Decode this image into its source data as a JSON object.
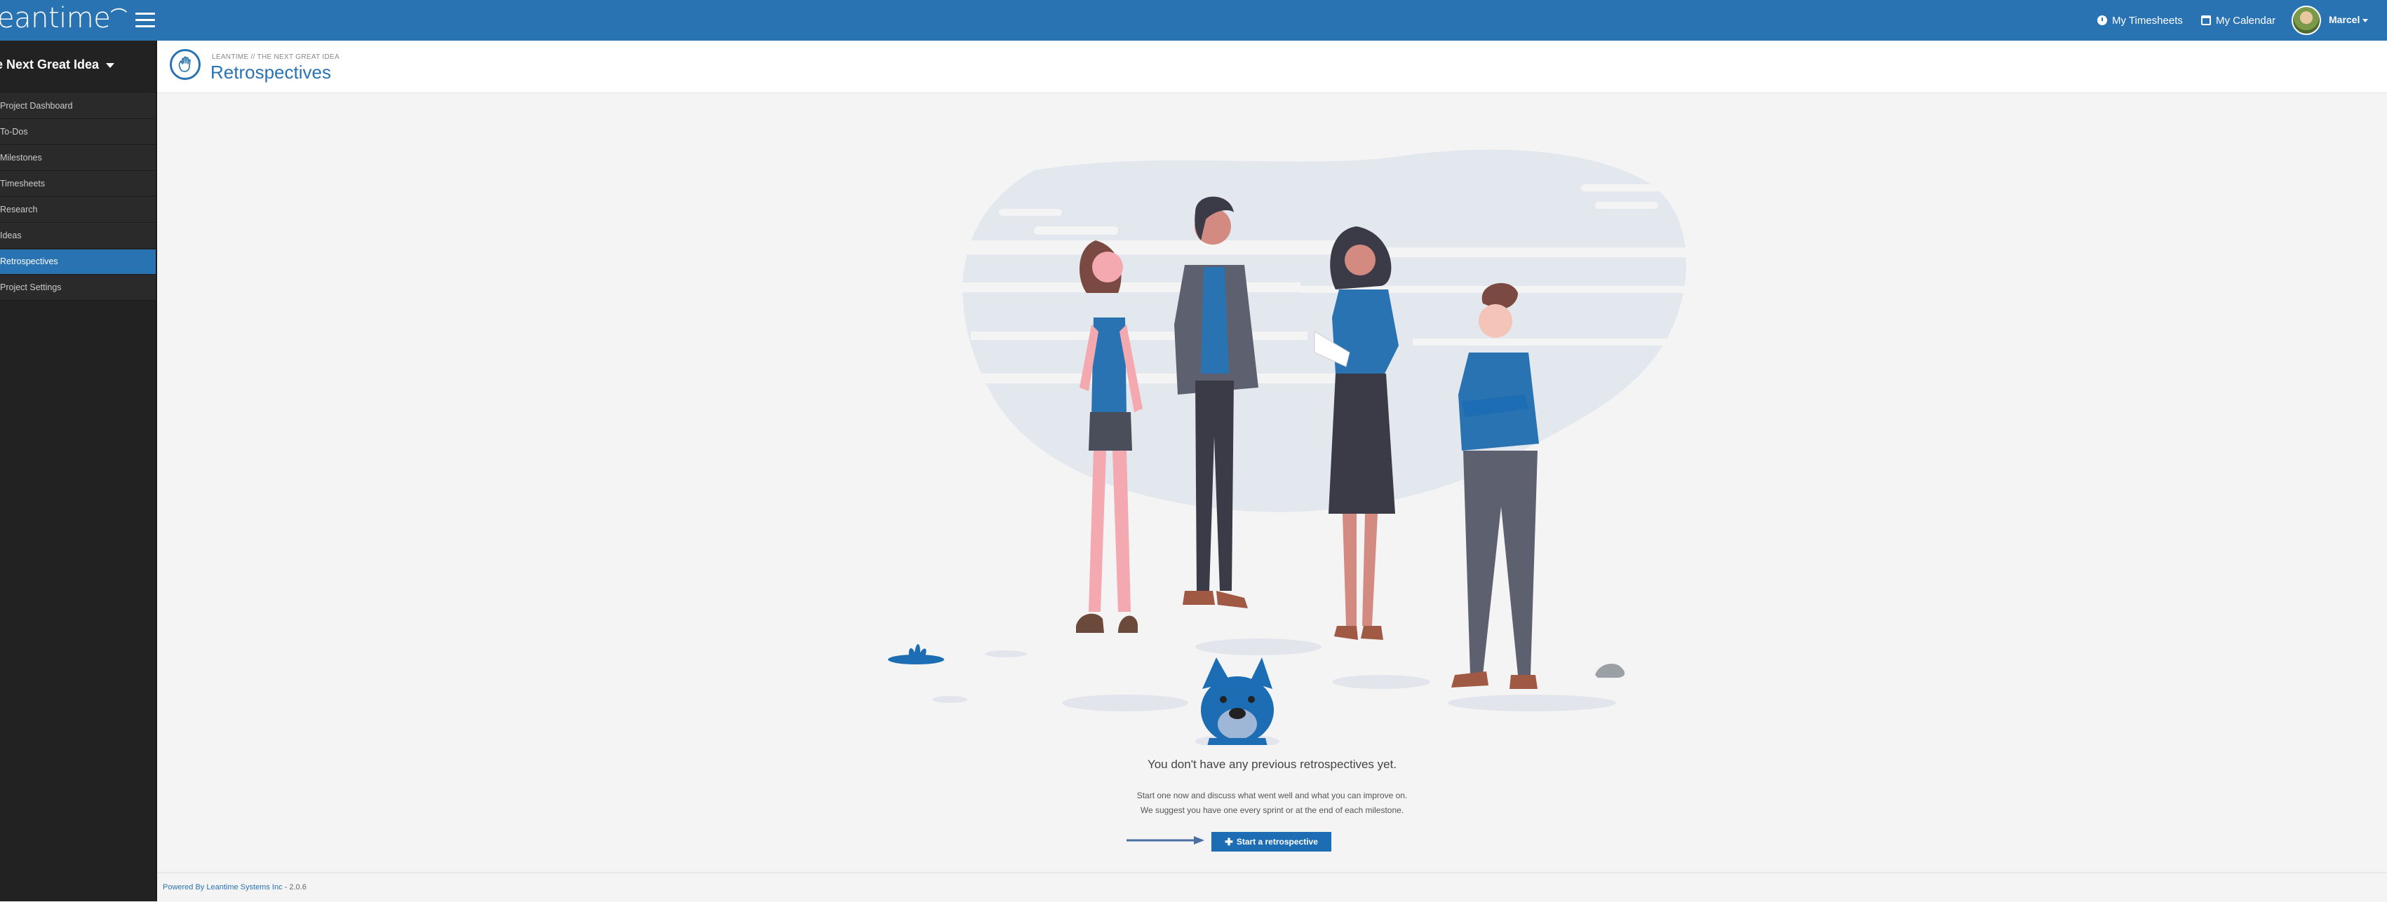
{
  "app": {
    "logo_text": "eantime",
    "colors": {
      "brand": "#2a73b2",
      "sidebar_bg": "#222222",
      "active_item": "#2a73b2"
    }
  },
  "topbar": {
    "menu_icon": "hamburger-icon",
    "timesheets_label": "My Timesheets",
    "timesheets_icon": "clock-icon",
    "calendar_label": "My Calendar",
    "calendar_icon": "calendar-icon",
    "user_name": "Marcel"
  },
  "sidebar": {
    "project_name": "e Next Great Idea",
    "items": [
      {
        "label": " Project Dashboard"
      },
      {
        "label": "To-Dos"
      },
      {
        "label": " Milestones"
      },
      {
        "label": " Timesheets"
      },
      {
        "label": " Research"
      },
      {
        "label": "Ideas"
      },
      {
        "label": " Retrospectives",
        "active": true
      },
      {
        "label": " Project Settings"
      }
    ]
  },
  "header": {
    "breadcrumb": "LEANTIME // THE NEXT GREAT IDEA",
    "title": "Retrospectives",
    "icon": "hand-wave-icon"
  },
  "empty_state": {
    "title": "You don't have any previous retrospectives yet.",
    "line1": "Start one now and discuss what went well and what you can improve on.",
    "line2": "We suggest you have one every sprint or at the end of each milestone.",
    "button_label": "Start a retrospective",
    "button_icon": "plus-icon",
    "arrow_icon": "arrow-right-icon"
  },
  "footer": {
    "powered_by": "Powered By Leantime Systems Inc",
    "version": " - 2.0.6"
  }
}
